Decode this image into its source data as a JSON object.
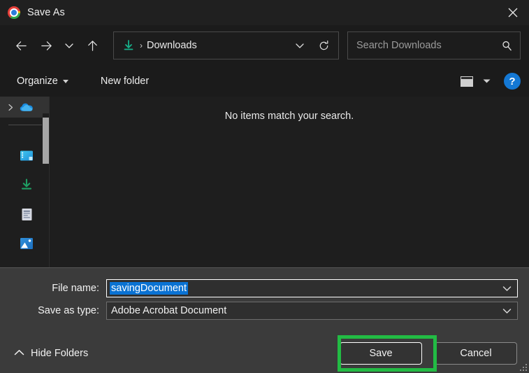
{
  "window": {
    "title": "Save As",
    "app_icon": "chrome-logo-icon",
    "close_label": "✕"
  },
  "toolbar": {
    "back_icon": "back-arrow-icon",
    "forward_icon": "forward-arrow-icon",
    "recent_icon": "chevron-down-icon",
    "up_icon": "up-arrow-icon",
    "address": {
      "folder_icon": "downloads-folder-icon",
      "separator": "›",
      "breadcrumb": "Downloads",
      "dropdown_icon": "chevron-down-icon",
      "refresh_icon": "refresh-icon"
    },
    "search": {
      "value": "",
      "placeholder": "Search Downloads",
      "icon": "search-icon"
    }
  },
  "commandbar": {
    "organize_label": "Organize",
    "new_folder_label": "New folder",
    "view_icon": "view-mode-icon",
    "view_caret_icon": "chevron-down-icon",
    "help_label": "?"
  },
  "sidebar": {
    "items": [
      {
        "label": "",
        "icon": "onedrive-cloud-icon",
        "selected": true,
        "has_chevron": true
      },
      {
        "label": "",
        "icon": "desktop-icon",
        "selected": false,
        "has_chevron": false
      },
      {
        "label": "",
        "icon": "downloads-icon",
        "selected": false,
        "has_chevron": false
      },
      {
        "label": "",
        "icon": "documents-icon",
        "selected": false,
        "has_chevron": false
      },
      {
        "label": "",
        "icon": "pictures-icon",
        "selected": false,
        "has_chevron": false
      }
    ],
    "scrollbar": "vertical-scrollbar"
  },
  "filelist": {
    "empty_message": "No items match your search."
  },
  "form": {
    "file_name_label": "File name:",
    "file_name_value": "savingDocument",
    "file_name_selected": true,
    "save_as_type_label": "Save as type:",
    "save_as_type_value": "Adobe Acrobat Document",
    "dropdown_icon": "chevron-down-icon"
  },
  "footer": {
    "hide_folders_label": "Hide Folders",
    "hide_folders_icon": "chevron-up-icon",
    "save_label": "Save",
    "cancel_label": "Cancel"
  },
  "annotation": {
    "highlight_color": "#22bb44",
    "target": "save-button"
  },
  "colors": {
    "window_bg": "#1e1e1e",
    "titlebar_bg": "#202020",
    "panel_bg": "#3b3b3b",
    "selection_blue": "#0a72d3",
    "accent_help": "#1478d4",
    "highlight_green": "#22bb44"
  }
}
